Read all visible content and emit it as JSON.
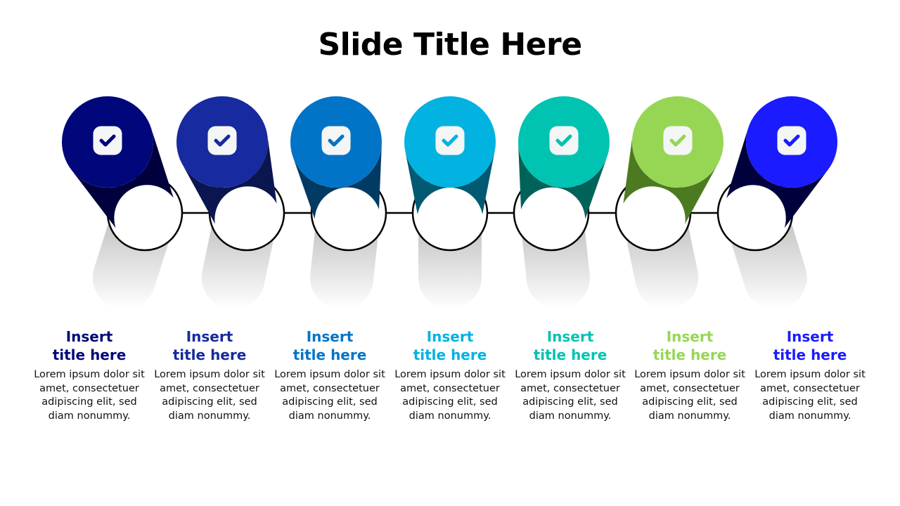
{
  "slide": {
    "title": "Slide Title Here"
  },
  "steps": [
    {
      "title_line1": "Insert",
      "title_line2": "title here",
      "body": "Lorem ipsum dolor sit amet, consectetuer adipiscing elit, sed diam nonummy.",
      "icon": "checkbox-icon",
      "top_color": "#00077A",
      "side_color": "#00003C",
      "title_color": "#00077A"
    },
    {
      "title_line1": "Insert",
      "title_line2": "title here",
      "body": "Lorem ipsum dolor sit amet, consectetuer adipiscing elit, sed diam nonummy.",
      "icon": "checkbox-icon",
      "top_color": "#172A9F",
      "side_color": "#0B1650",
      "title_color": "#172A9F"
    },
    {
      "title_line1": "Insert",
      "title_line2": "title here",
      "body": "Lorem ipsum dolor sit amet, consectetuer adipiscing elit, sed diam nonummy.",
      "icon": "checkbox-icon",
      "top_color": "#0274C7",
      "side_color": "#013A63",
      "title_color": "#0274C7"
    },
    {
      "title_line1": "Insert",
      "title_line2": "title here",
      "body": "Lorem ipsum dolor sit amet, consectetuer adipiscing elit, sed diam nonummy.",
      "icon": "checkbox-icon",
      "top_color": "#02B2E1",
      "side_color": "#015A71",
      "title_color": "#02B2E1"
    },
    {
      "title_line1": "Insert",
      "title_line2": "title here",
      "body": "Lorem ipsum dolor sit amet, consectetuer adipiscing elit, sed diam nonummy.",
      "icon": "checkbox-icon",
      "top_color": "#01C3B2",
      "side_color": "#01625A",
      "title_color": "#01C3B2"
    },
    {
      "title_line1": "Insert",
      "title_line2": "title here",
      "body": "Lorem ipsum dolor sit amet, consectetuer adipiscing elit, sed diam nonummy.",
      "icon": "checkbox-icon",
      "top_color": "#97D654",
      "side_color": "#4C7A20",
      "title_color": "#97D654"
    },
    {
      "title_line1": "Insert",
      "title_line2": "title here",
      "body": "Lorem ipsum dolor sit amet, consectetuer adipiscing elit, sed diam nonummy.",
      "icon": "checkbox-icon",
      "top_color": "#1A1BFF",
      "side_color": "#00003C",
      "title_color": "#1A1BFF"
    }
  ]
}
